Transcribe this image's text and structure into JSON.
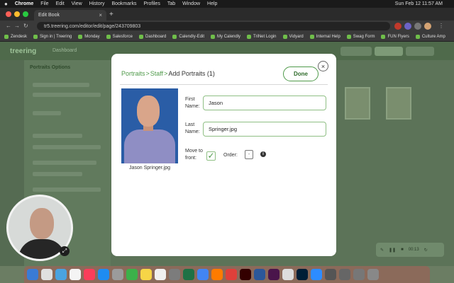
{
  "menubar": {
    "apple": "",
    "items": [
      "Chrome",
      "File",
      "Edit",
      "View",
      "History",
      "Bookmarks",
      "Profiles",
      "Tab",
      "Window",
      "Help"
    ],
    "clock": "Sun Feb 12  11:57 AM"
  },
  "browser": {
    "tab_title": "Edit Book",
    "url": "tr5.treering.com/editor/edit/page/243709803",
    "bookmarks": [
      "Zendesk",
      "Sign in | Treering",
      "Monday",
      "Salesforce",
      "Dashboard",
      "Calendly-Edit",
      "My Calendly",
      "TriNet Login",
      "Vidyard",
      "Internal Help",
      "Swag Form",
      "FUN Flyers",
      "Culture Amp"
    ]
  },
  "app": {
    "logo": "treering",
    "nav_dashboard": "Dashboard",
    "panel_title": "Portraits Options"
  },
  "modal": {
    "breadcrumb": {
      "portraits": "Portraits",
      "staff": "Staff",
      "current": "Add Portraits (1)",
      "sep": ">"
    },
    "done_label": "Done",
    "close_label": "×",
    "photo_caption": "Jason Springer.jpg",
    "first_name_label": "First Name:",
    "first_name_value": "Jason",
    "last_name_label": "Last Name:",
    "last_name_value": "Springer.jpg",
    "move_to_front_label": "Move to front:",
    "move_to_front_checked": true,
    "order_label": "Order:",
    "order_value": "-",
    "info_icon": "i"
  },
  "video_toolbar": {
    "timer": "00:13"
  },
  "colors": {
    "accent_green": "#4f9a4a",
    "field_border": "#8fbf84",
    "photo_bg": "#2a5da6"
  },
  "icons": [
    "apple-logo",
    "search-icon",
    "close-icon",
    "checkmark-icon",
    "info-icon",
    "expand-icon",
    "pause-icon",
    "stop-icon",
    "restart-icon"
  ]
}
